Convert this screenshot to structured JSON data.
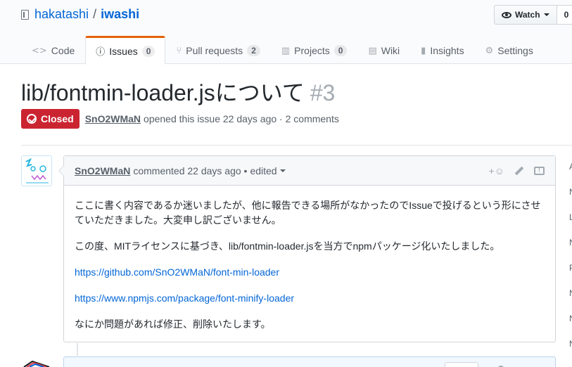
{
  "repo": {
    "owner": "hakatashi",
    "separator": "/",
    "name": "iwashi"
  },
  "watch": {
    "label": "Watch",
    "count": "0"
  },
  "tabs": [
    {
      "label": "Code",
      "icon": "code-icon"
    },
    {
      "label": "Issues",
      "count": "0",
      "icon": "issue-icon",
      "selected": true
    },
    {
      "label": "Pull requests",
      "count": "2",
      "icon": "pull-request-icon"
    },
    {
      "label": "Projects",
      "count": "0",
      "icon": "project-icon"
    },
    {
      "label": "Wiki",
      "icon": "book-icon"
    },
    {
      "label": "Insights",
      "icon": "graph-icon"
    },
    {
      "label": "Settings",
      "icon": "gear-icon"
    }
  ],
  "issue": {
    "title": "lib/fontmin-loader.jsについて",
    "number": "#3",
    "state": "Closed",
    "author": "SnO2WMaN",
    "meta_text": "opened this issue 22 days ago · 2 comments"
  },
  "comment": {
    "author": "SnO2WMaN",
    "time_text": "commented 22 days ago •",
    "edited": "edited",
    "reaction": "+☺",
    "paragraphs": [
      "ここに書く内容であるか迷いましたが、他に報告できる場所がなかったのでIssueで投げるという形にさせていただきました。大変申し訳ございません。",
      "この度、MITライセンスに基づき、lib/fontmin-loader.jsを当方でnpmパッケージ化いたしました。"
    ],
    "links": [
      "https://github.com/SnO2WMaN/font-min-loader",
      "https://www.npmjs.com/package/font-minify-loader"
    ],
    "closing": "なにか問題があれば修正、削除いたします。"
  },
  "sidebar_letters": [
    "A",
    "N",
    "L",
    "N",
    "P",
    "N",
    "N",
    "N"
  ],
  "colors": {
    "accent_tab": "#e36209",
    "closed_red": "#cb2431",
    "link_blue": "#0366d6"
  }
}
